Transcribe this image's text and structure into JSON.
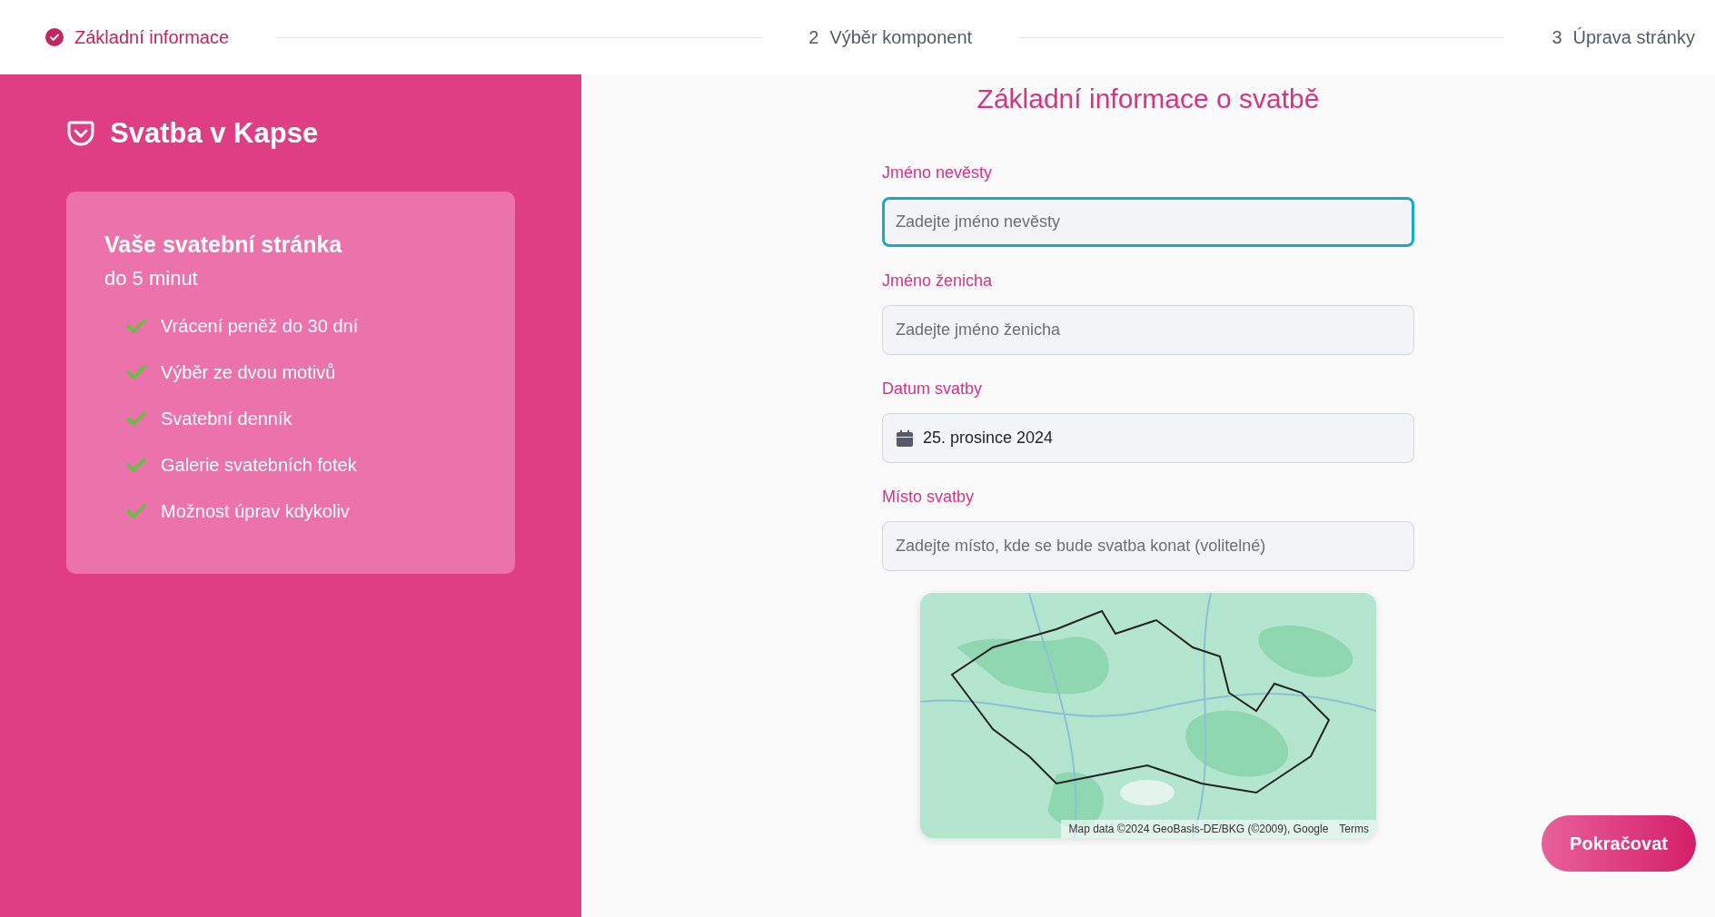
{
  "steps": [
    {
      "label": "Základní informace",
      "done": true
    },
    {
      "number": "2",
      "label": "Výběr komponent",
      "done": false
    },
    {
      "number": "3",
      "label": "Úprava stránky",
      "done": false
    }
  ],
  "sidebar": {
    "brand": "Svatba v Kapse",
    "card": {
      "title": "Vaše svatební stránka",
      "subtitle": "do 5 minut",
      "features": [
        "Vrácení peněž do 30 dní",
        "Výběr ze dvou motivů",
        "Svatební denník",
        "Galerie svatebních fotek",
        "Možnost úprav kdykoliv"
      ]
    }
  },
  "form": {
    "title": "Základní informace o svatbě",
    "fields": [
      {
        "kind": "text",
        "label": "Jméno nevěsty",
        "placeholder": "Zadejte jméno nevěsty",
        "focused": true
      },
      {
        "kind": "text",
        "label": "Jméno ženicha",
        "placeholder": "Zadejte jméno ženicha",
        "focused": false
      },
      {
        "kind": "date",
        "label": "Datum svatby",
        "value": "25. prosince 2024",
        "focused": false
      },
      {
        "kind": "text",
        "label": "Místo svatby",
        "placeholder": "Zadejte místo, kde se bude svatba konat (volitelné)",
        "focused": false
      }
    ],
    "map": {
      "kind": "picture",
      "attribution": "Map data ©2024 GeoBasis-DE/BKG (©2009), Google",
      "terms": "Terms"
    }
  },
  "continue_button": "Pokračovat"
}
